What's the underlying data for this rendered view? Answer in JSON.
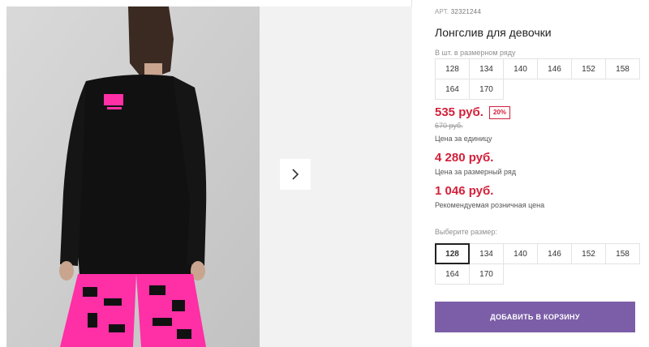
{
  "product": {
    "article_label": "АРТ.",
    "article_number": "32321244",
    "title": "Лонгслив для девочки"
  },
  "size_range": {
    "label": "В шт. в размерном ряду",
    "sizes": [
      "128",
      "134",
      "140",
      "146",
      "152",
      "158",
      "164",
      "170"
    ]
  },
  "pricing": {
    "unit_price": "535 руб.",
    "discount_badge": "20%",
    "old_price": "670 руб.",
    "unit_caption": "Цена за единицу",
    "range_price": "4 280 руб.",
    "range_caption": "Цена за размерный ряд",
    "retail_price": "1 046 руб.",
    "retail_caption": "Рекомендуемая розничная цена"
  },
  "size_select": {
    "label": "Выберите размер:",
    "selected": "128",
    "sizes": [
      "128",
      "134",
      "140",
      "146",
      "152",
      "158",
      "164",
      "170"
    ]
  },
  "cart": {
    "button_label": "ДОБАВИТЬ В КОРЗИНУ"
  },
  "colors": {
    "price_red": "#d3203a",
    "button_purple": "#7b5ea7",
    "print_pink": "#ff2fa6"
  },
  "icons": {
    "next": "chevron-right-icon"
  }
}
